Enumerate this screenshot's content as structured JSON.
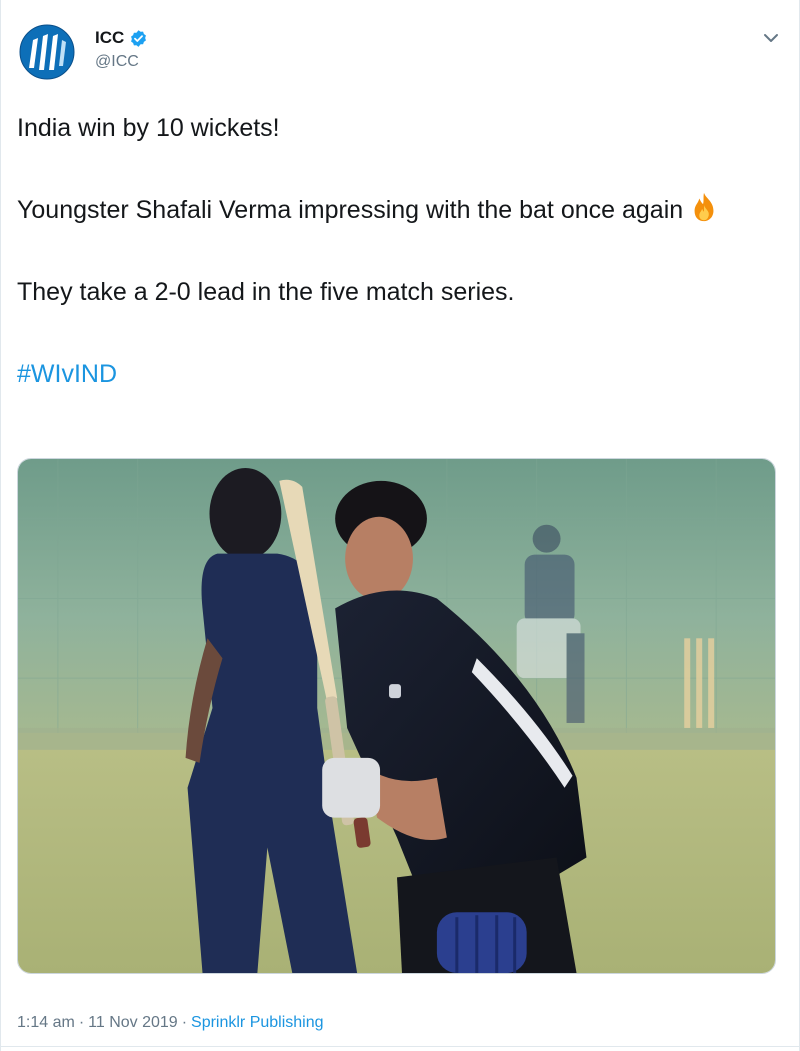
{
  "author": {
    "display_name": "ICC",
    "handle": "@ICC",
    "verified": true,
    "avatar_icon": "icc-logo-icon"
  },
  "tweet": {
    "line1": "India win by 10 wickets!",
    "line2": "Youngster Shafali Verma impressing with the bat once again",
    "line2_emoji": "fire-emoji",
    "line3": "They take a 2-0 lead in the five match series.",
    "hashtag": "#WIvIND"
  },
  "footer": {
    "time": "1:14 am",
    "separator": "·",
    "date": "11 Nov 2019",
    "separator2": "·",
    "source": "Sprinklr Publishing"
  },
  "colors": {
    "link": "#1b95e0",
    "text": "#14171a",
    "muted": "#657786",
    "verified": "#1da1f2"
  }
}
